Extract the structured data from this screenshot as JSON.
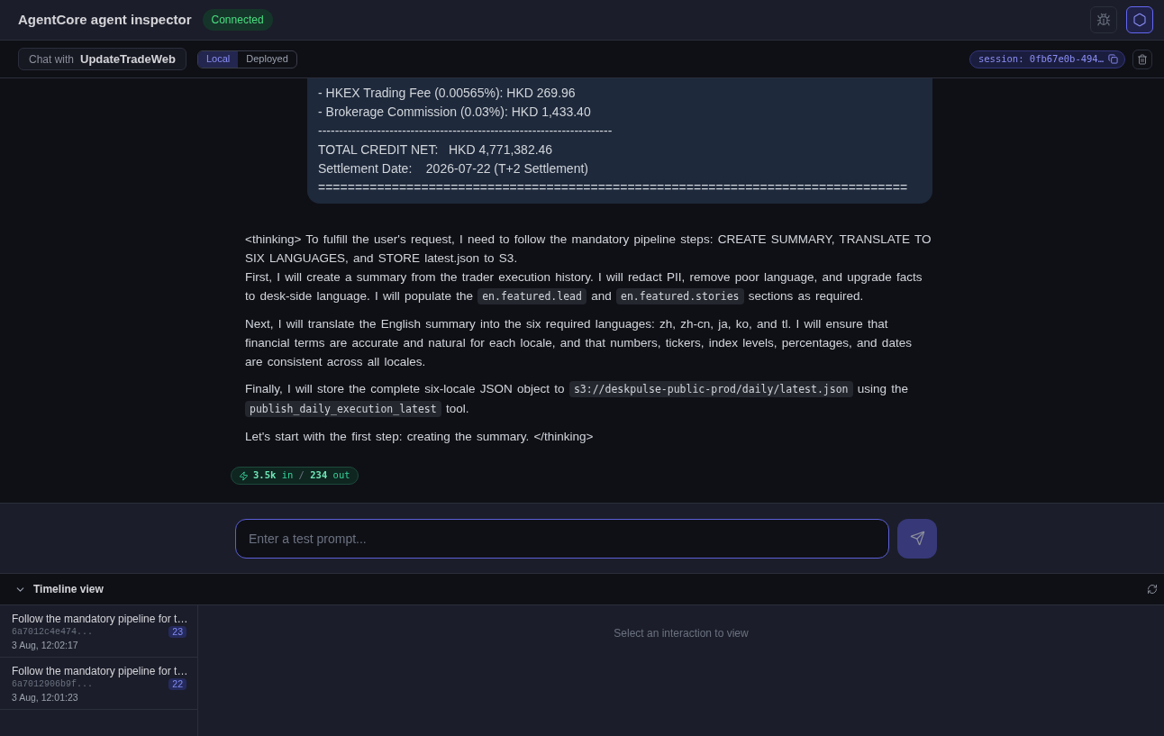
{
  "header": {
    "title": "AgentCore agent inspector",
    "status": {
      "label": "Connected",
      "kind": "connected"
    },
    "buttons": [
      {
        "kind": "debug",
        "selected": false
      },
      {
        "kind": "hexagon",
        "selected": true
      }
    ]
  },
  "toolbar": {
    "chat_with_label": "Chat with",
    "agent_name": "UpdateTradeWeb",
    "modes": [
      {
        "label": "Local",
        "selected": true
      },
      {
        "label": "Deployed",
        "selected": false
      }
    ],
    "session": "session: 0fb67e0b-494…"
  },
  "chat": {
    "messages": [
      {
        "kind": "bubble",
        "lines": [
          "- HKEX Trading Fee (0.00565%): HKD 269.96",
          "- Brokerage Commission (0.03%): HKD 1,433.40",
          "----------------------------------------------------------------------",
          "TOTAL CREDIT NET:   HKD 4,771,382.46",
          "Settlement Date:    2026-07-22 (T+2 Settlement)",
          "================================================================================"
        ]
      },
      {
        "kind": "plain",
        "paragraphs": [
          [
            [
              {
                "kind": "text",
                "text": "<thinking> To fulfill the user's request, I need to follow the mandatory pipeline steps: CREATE SUMMARY, TRANSLATE TO SIX LANGUAGES, and STORE latest.json to S3."
              }
            ],
            [
              {
                "kind": "text",
                "text": "First, I will create a summary from the trader execution history. I will redact PII, remove poor language, and upgrade facts to desk-side language. I will populate the "
              },
              {
                "kind": "code",
                "text": "en.featured.lead"
              },
              {
                "kind": "text",
                "text": " and "
              },
              {
                "kind": "code",
                "text": "en.featured.stories"
              },
              {
                "kind": "text",
                "text": " sections as required."
              }
            ]
          ],
          [
            [
              {
                "kind": "text",
                "text": "Next, I will translate the English summary into the six required languages: zh, zh-cn, ja, ko, and tl. I will ensure that financial terms are accurate and natural for each locale, and that numbers, tickers, index levels, percentages, and dates are consistent across all locales."
              }
            ]
          ],
          [
            [
              {
                "kind": "text",
                "text": "Finally, I will store the complete six-locale JSON object to "
              },
              {
                "kind": "code",
                "text": "s3://deskpulse-public-prod/daily/latest.json"
              },
              {
                "kind": "text",
                "text": " using the "
              },
              {
                "kind": "code",
                "text": "publish_daily_execution_latest"
              },
              {
                "kind": "text",
                "text": " tool."
              }
            ]
          ],
          [
            [
              {
                "kind": "text",
                "text": "Let's start with the first step: creating the summary. </thinking>"
              }
            ]
          ]
        ],
        "usage": {
          "input": "3.5k",
          "input_label": "in",
          "separator": "/",
          "output": "234",
          "output_label": "out"
        }
      }
    ]
  },
  "composer": {
    "placeholder": "Enter a test prompt...",
    "focused": true,
    "send_disabled": true
  },
  "timeline": {
    "title": "Timeline view",
    "expanded": true,
    "items": [
      {
        "title": "Follow the mandatory pipeline for t…",
        "id": "6a7012c4e474...",
        "count": "23",
        "time": "3 Aug, 12:02:17",
        "selected": false
      },
      {
        "title": "Follow the mandatory pipeline for t…",
        "id": "6a7012906b9f...",
        "count": "22",
        "time": "3 Aug, 12:01:23",
        "selected": false
      }
    ],
    "empty_text": "Select an interaction to view"
  }
}
